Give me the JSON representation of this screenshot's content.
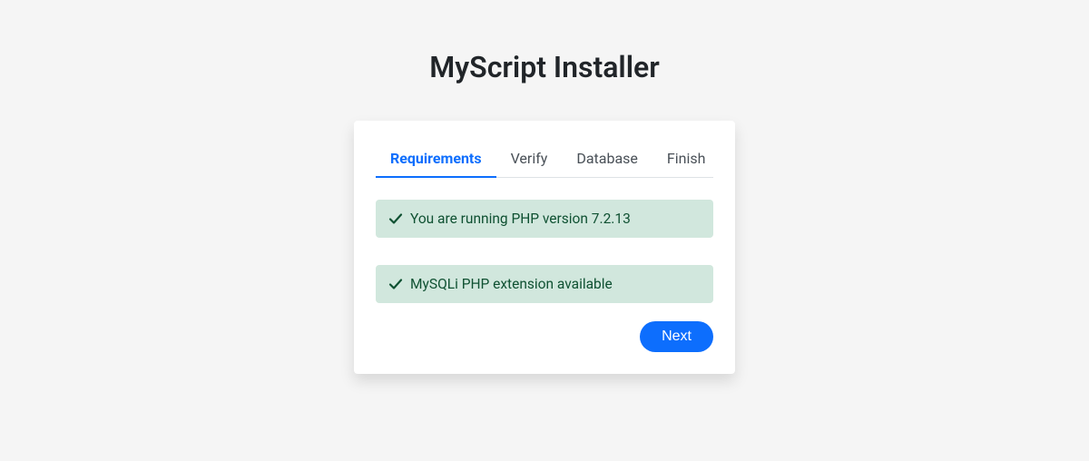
{
  "header": {
    "title": "MyScript Installer"
  },
  "tabs": [
    {
      "label": "Requirements",
      "active": true
    },
    {
      "label": "Verify",
      "active": false
    },
    {
      "label": "Database",
      "active": false
    },
    {
      "label": "Finish",
      "active": false
    }
  ],
  "alerts": [
    {
      "status": "success",
      "message": "You are running PHP version 7.2.13"
    },
    {
      "status": "success",
      "message": "MySQLi PHP extension available"
    }
  ],
  "actions": {
    "next_label": "Next"
  },
  "colors": {
    "primary": "#0d6efd",
    "success_bg": "#d1e7dd",
    "success_text": "#0f5132",
    "page_bg": "#f5f5f5"
  }
}
